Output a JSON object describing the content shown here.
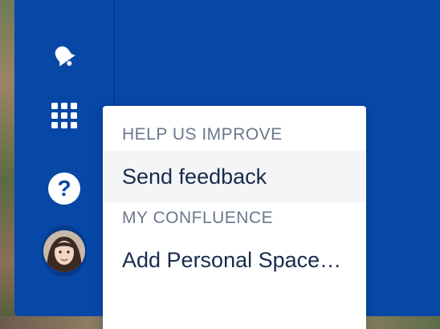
{
  "sidebar": {
    "items": [
      {
        "name": "notifications",
        "icon": "bell-icon"
      },
      {
        "name": "app-switcher",
        "icon": "grid-icon"
      },
      {
        "name": "help",
        "icon": "help-icon",
        "glyph": "?"
      },
      {
        "name": "profile",
        "icon": "avatar"
      }
    ]
  },
  "dropdown": {
    "sections": [
      {
        "heading": "HELP US IMPROVE",
        "items": [
          {
            "label": "Send feedback",
            "hovered": true
          }
        ]
      },
      {
        "heading": "MY CONFLUENCE",
        "items": [
          {
            "label": "Add Personal Space…",
            "hovered": false
          }
        ]
      }
    ]
  },
  "colors": {
    "sidebar_bg": "#0747a6",
    "menu_bg": "#ffffff",
    "menu_hover": "#f4f5f7",
    "heading_text": "#6b778c",
    "item_text": "#172b4d"
  }
}
